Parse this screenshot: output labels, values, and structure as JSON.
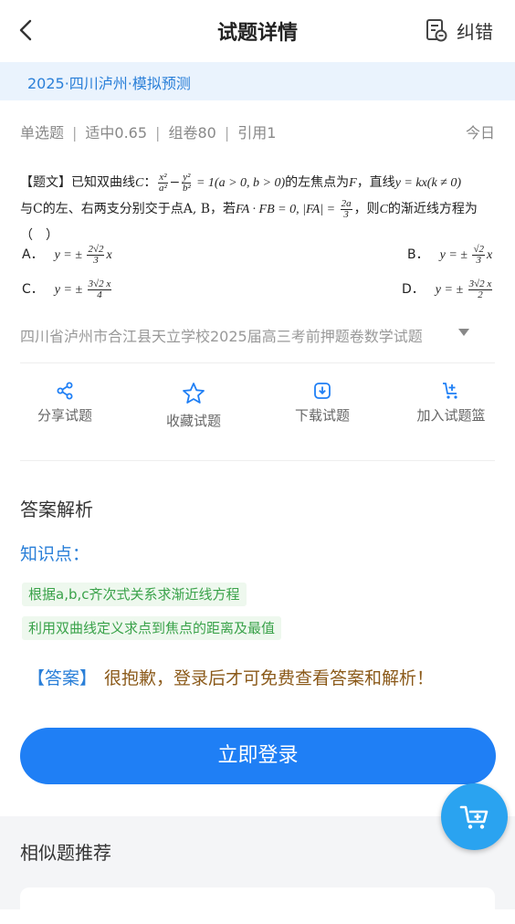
{
  "header": {
    "title": "试题详情",
    "report_label": "纠错"
  },
  "source": {
    "text": "2025·四川泸州·模拟预测"
  },
  "meta": {
    "type": "单选题",
    "difficulty": "适中0.65",
    "group": "组卷80",
    "cite": "引用1",
    "date": "今日"
  },
  "question": {
    "prefix": "【题文】已知双曲线",
    "line2": "与C的左、右两支分别交于点A, B，若",
    "line3": "（　）"
  },
  "options": [
    {
      "label": "A．",
      "expr": "y = ± 2√2⁄3 x"
    },
    {
      "label": "B．",
      "expr": "y = ± √2⁄3 x"
    },
    {
      "label": "C．",
      "expr": "y = ± 3√2 x⁄4"
    },
    {
      "label": "D．",
      "expr": "y = ± 3√2 x⁄2"
    }
  ],
  "paper": {
    "title": "四川省泸州市合江县天立学校2025届高三考前押题卷数学试题"
  },
  "actions": [
    {
      "label": "分享试题",
      "icon": "share-icon"
    },
    {
      "label": "收藏试题",
      "icon": "star-icon"
    },
    {
      "label": "下载试题",
      "icon": "download-icon"
    },
    {
      "label": "加入试题篮",
      "icon": "cart-add-icon"
    }
  ],
  "analysis": {
    "title": "答案解析",
    "knowledge_label": "知识点：",
    "tags": [
      "根据a,b,c齐次式关系求渐近线方程",
      "利用双曲线定义求点到焦点的距离及最值"
    ],
    "answer_bracket": "【答案】",
    "answer_text": "很抱歉，登录后才可免费查看答案和解析！"
  },
  "login_button": "立即登录",
  "similar": {
    "title": "相似题推荐"
  },
  "colors": {
    "accent": "#1f7ff5",
    "link": "#2a7fd8",
    "tag_green": "#3aa24a",
    "answer_brown": "#8b5a1a"
  }
}
